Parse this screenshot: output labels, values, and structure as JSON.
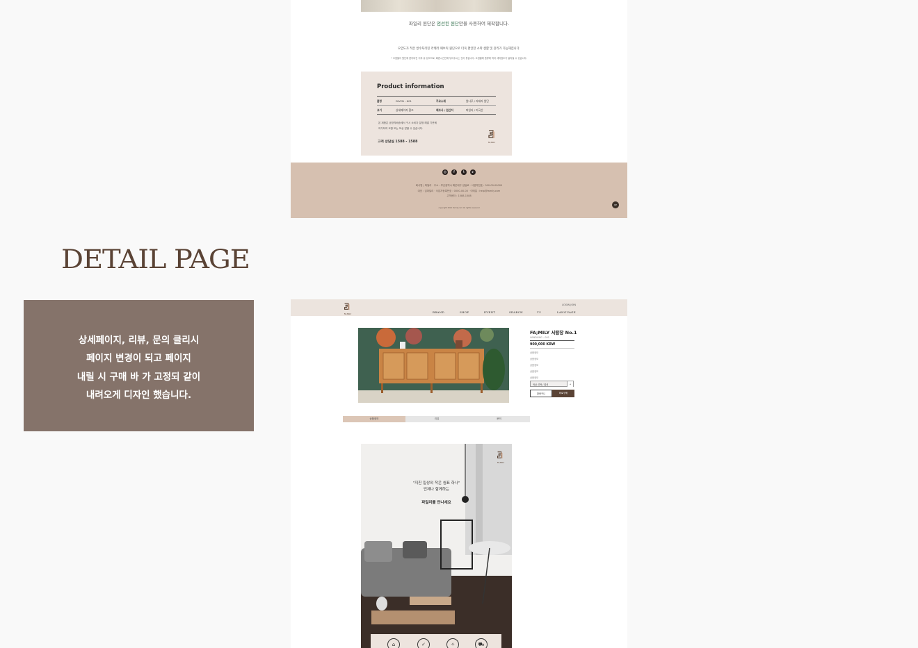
{
  "top_section": {
    "material_caption_prefix": "파일리 원단은 ",
    "material_caption_highlight": "엄선된 원단",
    "material_caption_suffix": "만을 사용하여 제작합니다.",
    "care_note": "오염도가 적은 방수처리된 라테라 패브릭 원단으로 더욱 편안한 소파 생활 및 관리가 가능해집니다.",
    "care_note_small": "* 오염물이 원단에 묻어버린 이후 유 있으므로, 빠른시간안에 닦아주시는 것이 좋습니다. 오염물에 종류에 따라 세탁정도가 달라질 수 있습니다.",
    "product_info": {
      "title": "Product information",
      "rows": [
        {
          "label1": "품명",
          "value1": "DIVEN - 601",
          "label2": "주요소재",
          "value2": "원나무 / 라테라 원단"
        },
        {
          "label1": "크기",
          "value1": "상세페이지 참조",
          "label2": "제조사 / 원산지",
          "value2": "파일리 / 미국산"
        }
      ],
      "note_line1": "본 제품은 공장직배송에서 구시 소비자 분쟁 해결 기준에",
      "note_line2": "의거하여 교환 또는 보상 받을 수 있습니다.",
      "cs": "고객 상담실 1588 - 1588",
      "logo_text": "FA;MILY"
    },
    "footer": {
      "social": [
        "instagram-icon",
        "facebook-icon",
        "twitter-icon",
        "youtube-icon"
      ],
      "line1": "회사명 | 파밀리 · 주소 : 부산광역시 해운대구 센텀로 · 사업자번호 : 000-00-00000",
      "line2": "대표 : 김파밀리 · 사업자등록번호 : 0000-00-00 · 이메일 : help@family.com",
      "line3": "고객센터 : 1588-1588",
      "copyright": "copyright 2021 family.com All rights reserved",
      "up": "UP"
    }
  },
  "section_heading": "DETAIL PAGE",
  "description": [
    "상세페이지, 리뷰, 문의 클리시",
    "페이지 변경이 되고 페이지",
    "내릴 시 구매 바 가 고정되 같이",
    "내려오게 디자인 했습니다."
  ],
  "detail_mock": {
    "logo_text": "FA;MILY",
    "login_links": "LOGIN  JOIN",
    "nav": [
      "BRAND",
      "SHOP",
      "EVENT",
      "SEARCH",
      "Y!!",
      "LANGUAGE"
    ],
    "product_title": "FA;MILY 서랍장 No.1",
    "product_sub": "VANDUNG - 001",
    "price": "900,000 KRW",
    "options": [
      "상품정보",
      "상품정보",
      "상품정보",
      "상품정보",
      "상품정보"
    ],
    "select_label": "색상 선택 / 옵션",
    "cart_label": "장바구니",
    "buy_label": "바로구매",
    "tabs": [
      "상품정보",
      "리뷰",
      "문의"
    ],
    "hero_quote": "\"지친 일상의 작은 쉼표 하나\"",
    "hero_line2": "언제나 함께하는",
    "hero_line3": "파밀리를 만나세요",
    "bottom_icons": [
      "delivery-icon",
      "quality-icon",
      "care-icon",
      "truck-icon"
    ]
  },
  "colors": {
    "accent_brown": "#5a4335",
    "desc_box": "#85736a",
    "footer_beige": "#d6c0b0",
    "panel_beige": "#ede4de"
  }
}
